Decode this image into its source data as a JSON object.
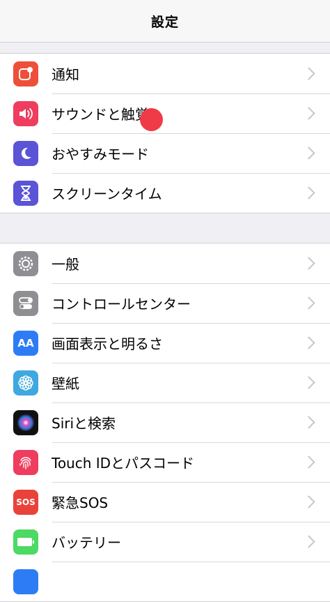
{
  "header": {
    "title": "設定"
  },
  "colors": {
    "notifications": "#ee4f3a",
    "sounds": "#ee3d5e",
    "dnd": "#5b54d6",
    "screentime": "#5b54d6",
    "general": "#8e8e93",
    "control": "#8e8e93",
    "display": "#2d7cf6",
    "wallpaper": "#3fa8e0",
    "siri": "#111111",
    "touchid": "#ee3d5e",
    "sos": "#e9423a",
    "battery": "#4cd964"
  },
  "group1": [
    {
      "label": "通知",
      "icon": "notification-icon"
    },
    {
      "label": "サウンドと触覚",
      "icon": "speaker-icon"
    },
    {
      "label": "おやすみモード",
      "icon": "moon-icon"
    },
    {
      "label": "スクリーンタイム",
      "icon": "hourglass-icon"
    }
  ],
  "group2": [
    {
      "label": "一般",
      "icon": "gear-icon"
    },
    {
      "label": "コントロールセンター",
      "icon": "toggles-icon"
    },
    {
      "label": "画面表示と明るさ",
      "icon": "text-size-icon",
      "icon_text": "AA"
    },
    {
      "label": "壁紙",
      "icon": "flower-icon"
    },
    {
      "label": "Siriと検索",
      "icon": "siri-icon"
    },
    {
      "label": "Touch IDとパスコード",
      "icon": "fingerprint-icon"
    },
    {
      "label": "緊急SOS",
      "icon": "sos-icon",
      "icon_text": "SOS"
    },
    {
      "label": "バッテリー",
      "icon": "battery-icon"
    }
  ]
}
